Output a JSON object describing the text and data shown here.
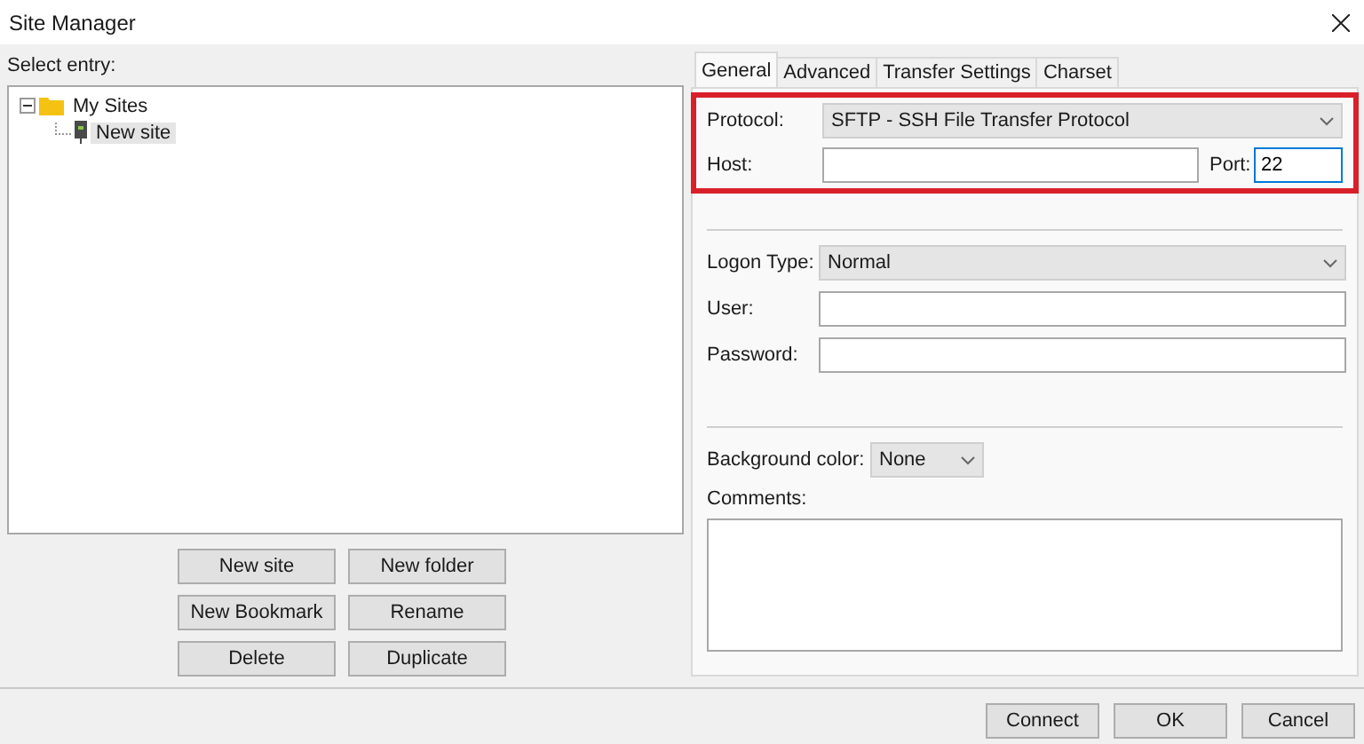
{
  "window": {
    "title": "Site Manager"
  },
  "entry_label": "Select entry:",
  "tree": [
    {
      "label": "My Sites",
      "kind": "folder",
      "expanded": true,
      "selected": false,
      "children": [
        {
          "label": "New site",
          "kind": "site",
          "selected": true
        }
      ]
    }
  ],
  "tree_buttons": [
    [
      "New site",
      "New folder"
    ],
    [
      "New Bookmark",
      "Rename"
    ],
    [
      "Delete",
      "Duplicate"
    ]
  ],
  "tabs": [
    {
      "label": "General",
      "selected": true
    },
    {
      "label": "Advanced",
      "selected": false
    },
    {
      "label": "Transfer Settings",
      "selected": false
    },
    {
      "label": "Charset",
      "selected": false
    }
  ],
  "general": {
    "protocol": {
      "label": "Protocol:",
      "value": "SFTP - SSH File Transfer Protocol"
    },
    "host": {
      "label": "Host:"
    },
    "port": {
      "label": "Port:",
      "value": "22"
    },
    "logon_type": {
      "label": "Logon Type:",
      "value": "Normal"
    },
    "user": {
      "label": "User:"
    },
    "password": {
      "label": "Password:"
    },
    "background_color": {
      "label": "Background color:",
      "value": "None"
    },
    "comments": {
      "label": "Comments:"
    }
  },
  "dialog_buttons": [
    "Connect",
    "OK",
    "Cancel"
  ]
}
